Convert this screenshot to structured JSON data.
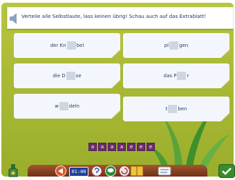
{
  "instruction": "Verteile alle Selbstlaute, lass keinen übrig! Schau auch auf das Extrablatt!",
  "cards": [
    {
      "pre": "der Kn",
      "post": "bel"
    },
    {
      "pre": "pl",
      "post": "gen"
    },
    {
      "pre": "die D",
      "post": "se"
    },
    {
      "pre": "das P",
      "post": "r"
    },
    {
      "pre": "w",
      "post": "deln"
    },
    {
      "pre": "t",
      "post": "ben"
    }
  ],
  "tiles": [
    "a",
    "a",
    "a",
    "a",
    "e",
    "e",
    "e"
  ],
  "clock": "01:00",
  "colors": {
    "background": "#a9b934",
    "tile": "#6b2c6f",
    "toolbar": "#8b4420",
    "clock": "#1f3f9a"
  }
}
